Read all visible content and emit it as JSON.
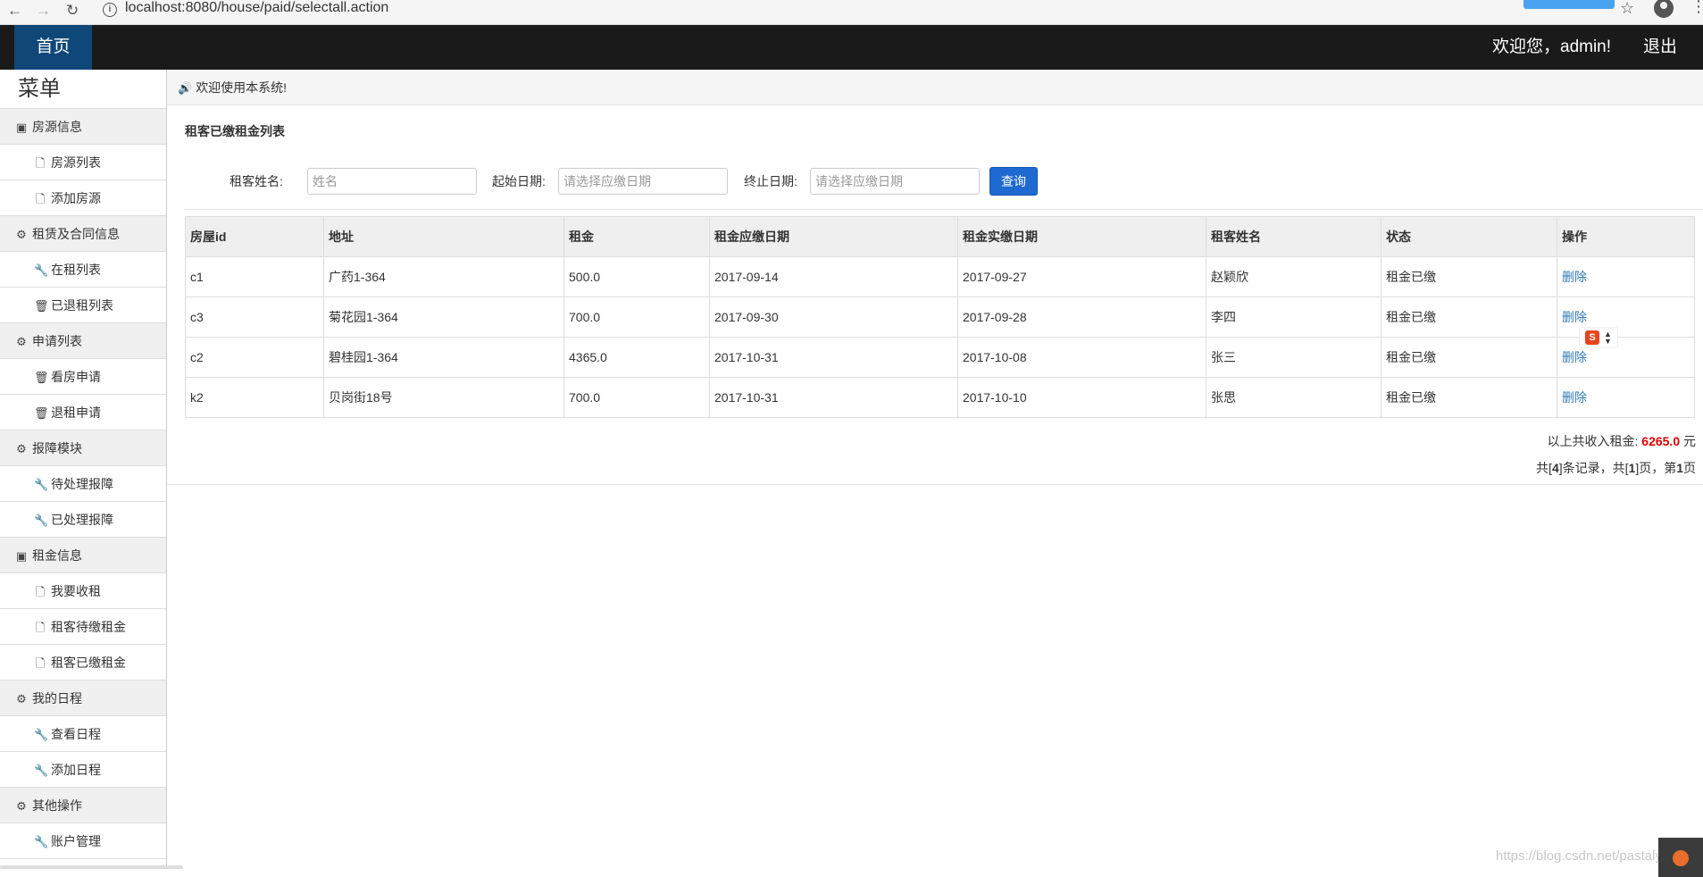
{
  "browser": {
    "url": "localhost:8080/house/paid/selectall.action",
    "back_icon": "←",
    "forward_icon": "→",
    "reload_icon": "↻",
    "star_icon": "☆",
    "menu_icon": "⋮"
  },
  "navbar": {
    "home": "首页",
    "welcome": "欢迎您，admin!",
    "logout": "退出"
  },
  "sidebar": {
    "title": "菜单",
    "groups": [
      {
        "label": "房源信息",
        "icon": "book-icon",
        "items": [
          {
            "label": "房源列表",
            "icon": "file-icon"
          },
          {
            "label": "添加房源",
            "icon": "file-icon"
          }
        ]
      },
      {
        "label": "租赁及合同信息",
        "icon": "gear-icon",
        "items": [
          {
            "label": "在租列表",
            "icon": "wrench-icon"
          },
          {
            "label": "已退租列表",
            "icon": "trash-icon"
          }
        ]
      },
      {
        "label": "申请列表",
        "icon": "gear-icon",
        "items": [
          {
            "label": "看房申请",
            "icon": "trash-icon"
          },
          {
            "label": "退租申请",
            "icon": "trash-icon"
          }
        ]
      },
      {
        "label": "报障模块",
        "icon": "gear-icon",
        "items": [
          {
            "label": "待处理报障",
            "icon": "wrench-icon"
          },
          {
            "label": "已处理报障",
            "icon": "wrench-icon"
          }
        ]
      },
      {
        "label": "租金信息",
        "icon": "book-icon",
        "items": [
          {
            "label": "我要收租",
            "icon": "file-icon"
          },
          {
            "label": "租客待缴租金",
            "icon": "file-icon"
          },
          {
            "label": "租客已缴租金",
            "icon": "file-icon"
          }
        ]
      },
      {
        "label": "我的日程",
        "icon": "gear-icon",
        "items": [
          {
            "label": "查看日程",
            "icon": "wrench-icon"
          },
          {
            "label": "添加日程",
            "icon": "wrench-icon"
          }
        ]
      },
      {
        "label": "其他操作",
        "icon": "gear-icon",
        "items": [
          {
            "label": "账户管理",
            "icon": "wrench-icon"
          }
        ]
      }
    ]
  },
  "main": {
    "welcome": "欢迎使用本系统!",
    "panel_title": "租客已缴租金列表",
    "search": {
      "name_label": "租客姓名:",
      "name_placeholder": "姓名",
      "start_label": "起始日期:",
      "start_placeholder": "请选择应缴日期",
      "end_label": "终止日期:",
      "end_placeholder": "请选择应缴日期",
      "button": "查询"
    },
    "table": {
      "headers": [
        "房屋id",
        "地址",
        "租金",
        "租金应缴日期",
        "租金实缴日期",
        "租客姓名",
        "状态",
        "操作"
      ],
      "rows": [
        [
          "c1",
          "广药1-364",
          "500.0",
          "2017-09-14",
          "2017-09-27",
          "赵颖欣",
          "租金已缴",
          "删除"
        ],
        [
          "c3",
          "菊花园1-364",
          "700.0",
          "2017-09-30",
          "2017-09-28",
          "李四",
          "租金已缴",
          "删除"
        ],
        [
          "c2",
          "碧桂园1-364",
          "4365.0",
          "2017-10-31",
          "2017-10-08",
          "张三",
          "租金已缴",
          "删除"
        ],
        [
          "k2",
          "贝岗街18号",
          "700.0",
          "2017-10-31",
          "2017-10-10",
          "张思",
          "租金已缴",
          "删除"
        ]
      ]
    },
    "summary": {
      "prefix": "以上共收入租金:",
      "amount": "6265.0",
      "suffix": "元"
    },
    "pagination": {
      "p1": "共[",
      "total": "4",
      "p2": "]条记录，共[",
      "pages": "1",
      "p3": "]页，第",
      "current": "1",
      "p4": "页"
    }
  },
  "watermark": "https://blog.csdn.net/pastalyeds"
}
